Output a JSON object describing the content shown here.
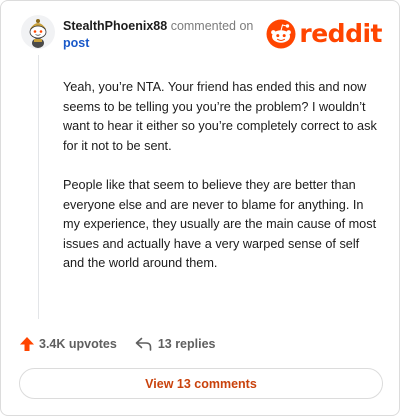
{
  "comment": {
    "username": "StealthPhoenix88",
    "action": "commented on",
    "target": "post",
    "paragraphs": [
      "Yeah, you’re NTA. Your friend has ended this and now seems to be telling you you’re the problem? I wouldn’t want to hear it either so you’re completely correct to ask for it not to be sent.",
      "People like that seem to believe they are better than everyone else and are never to blame for anything. In my experience, they usually are the main cause of most issues and actually have a very warped sense of self and the world around them."
    ]
  },
  "brand": {
    "wordmark": "reddit",
    "color": "#ff4500"
  },
  "footer": {
    "upvotes": "3.4K upvotes",
    "replies": "13 replies",
    "upvote_icon": "upvote-arrow-icon",
    "reply_icon": "reply-arrow-icon",
    "upvote_color": "#ff4500"
  },
  "view_comments": "View 13 comments"
}
